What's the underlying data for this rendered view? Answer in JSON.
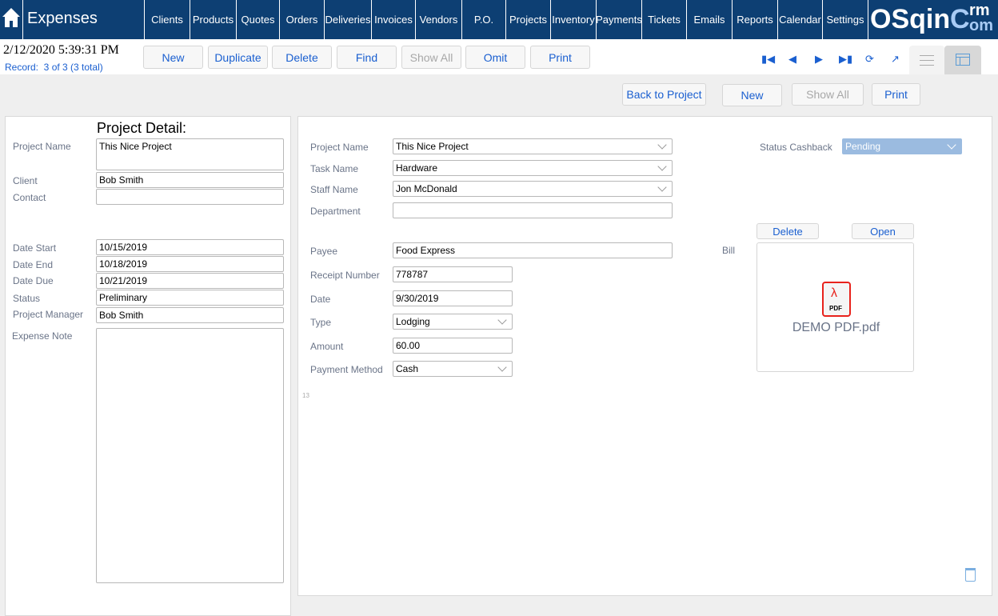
{
  "header": {
    "title": "Expenses",
    "logo_main": "OSqin",
    "logo_c": "C",
    "logo_rm": "rm",
    "logo_om": "om",
    "nav": [
      "Clients",
      "Products",
      "Quotes",
      "Orders",
      "Deliveries",
      "Invoices",
      "Vendors",
      "P.O.",
      "Projects",
      "Inventory",
      "Payments",
      "Tickets",
      "Emails",
      "Reports",
      "Calendar",
      "Settings"
    ]
  },
  "toolbar": {
    "datetime": "2/12/2020 5:39:31 PM",
    "record": "Record:  3 of 3 (3 total)",
    "buttons": [
      {
        "label": "New",
        "enabled": true
      },
      {
        "label": "Duplicate",
        "enabled": true
      },
      {
        "label": "Delete",
        "enabled": true
      },
      {
        "label": "Find",
        "enabled": true
      },
      {
        "label": "Show All",
        "enabled": false
      },
      {
        "label": "Omit",
        "enabled": true
      },
      {
        "label": "Print",
        "enabled": true
      }
    ],
    "icons": [
      "first-record-icon",
      "previous-record-icon",
      "next-record-icon",
      "last-record-icon",
      "refresh-icon",
      "external-link-icon",
      "list-view-icon",
      "form-view-icon"
    ]
  },
  "subbar": {
    "back": "Back to Project",
    "new": "New",
    "show_all": "Show All",
    "print": "Print"
  },
  "left": {
    "title": "Project Detail:",
    "project_name_label": "Project Name",
    "project_name": "This Nice Project",
    "client_label": "Client",
    "client": "Bob Smith",
    "contact_label": "Contact",
    "contact": "",
    "date_start_label": "Date Start",
    "date_start": "10/15/2019",
    "date_end_label": "Date End",
    "date_end": "10/18/2019",
    "date_due_label": "Date Due",
    "date_due": "10/21/2019",
    "status_label": "Status",
    "status": "Preliminary",
    "pm_label": "Project Manager",
    "pm": "Bob Smith",
    "note_label": "Expense Note",
    "note": ""
  },
  "main": {
    "project_name_label": "Project Name",
    "project_name": "This Nice Project",
    "task_label": "Task Name",
    "task": "Hardware",
    "staff_label": "Staff Name",
    "staff": "Jon McDonald",
    "dept_label": "Department",
    "dept": "",
    "payee_label": "Payee",
    "payee": "Food Express",
    "receipt_label": "Receipt Number",
    "receipt": "778787",
    "date_label": "Date",
    "date": "9/30/2019",
    "type_label": "Type",
    "type": "Lodging",
    "amount_label": "Amount",
    "amount": "60.00",
    "pm_label": "Payment Method",
    "pm": "Cash",
    "small_number": "13",
    "cashback_label": "Status Cashback",
    "cashback": "Pending",
    "bill_label": "Bill",
    "delete": "Delete",
    "open": "Open",
    "file": "DEMO PDF.pdf",
    "pdf_badge": "PDF"
  },
  "colors": {
    "nav": "#0d3f73",
    "accent": "#1a5fd0",
    "cashback": "#9bbbe0",
    "pdf": "#e8221c"
  }
}
